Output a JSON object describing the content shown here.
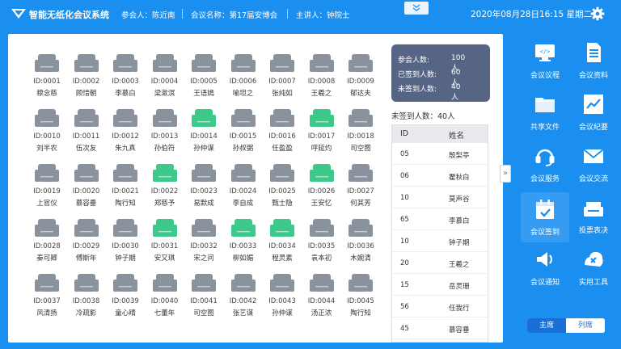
{
  "header": {
    "app_title": "智能无纸化会议系统",
    "participant": "参会人：陈近南",
    "meeting_name": "会议名称：第17届安博会",
    "speaker": "主讲人：钟院士",
    "datetime": "2020年08月28日16:15 星期二"
  },
  "colors": {
    "brand": "#1a8ff0",
    "seat_unsigned": "#8a929e",
    "seat_signed": "#3dc98a",
    "stats_bg": "#566485"
  },
  "seats": [
    {
      "id": "ID:0001",
      "name": "穆念慈",
      "signed": false
    },
    {
      "id": "ID:0002",
      "name": "顾惜朝",
      "signed": false
    },
    {
      "id": "ID:0003",
      "name": "李慕白",
      "signed": false
    },
    {
      "id": "ID:0004",
      "name": "梁漱溟",
      "signed": false
    },
    {
      "id": "ID:0005",
      "name": "王语嫣",
      "signed": false
    },
    {
      "id": "ID:0006",
      "name": "喻坦之",
      "signed": false
    },
    {
      "id": "ID:0007",
      "name": "张纯如",
      "signed": false
    },
    {
      "id": "ID:0008",
      "name": "王羲之",
      "signed": false
    },
    {
      "id": "ID:0009",
      "name": "郁达夫",
      "signed": false
    },
    {
      "id": "ID:0010",
      "name": "刘半农",
      "signed": false
    },
    {
      "id": "ID:0011",
      "name": "伍次友",
      "signed": false
    },
    {
      "id": "ID:0012",
      "name": "朱九真",
      "signed": false
    },
    {
      "id": "ID:0013",
      "name": "孙伯符",
      "signed": false
    },
    {
      "id": "ID:0014",
      "name": "孙仲谋",
      "signed": true
    },
    {
      "id": "ID:0015",
      "name": "孙叔弼",
      "signed": false
    },
    {
      "id": "ID:0016",
      "name": "任盈盈",
      "signed": false
    },
    {
      "id": "ID:0017",
      "name": "呼延灼",
      "signed": true
    },
    {
      "id": "ID:0018",
      "name": "司空图",
      "signed": false
    },
    {
      "id": "ID:0019",
      "name": "上官仪",
      "signed": false
    },
    {
      "id": "ID:0020",
      "name": "慕容垂",
      "signed": false
    },
    {
      "id": "ID:0021",
      "name": "陶行知",
      "signed": false
    },
    {
      "id": "ID:0022",
      "name": "郑慈予",
      "signed": true
    },
    {
      "id": "ID:0023",
      "name": "易默成",
      "signed": false
    },
    {
      "id": "ID:0024",
      "name": "李自成",
      "signed": false
    },
    {
      "id": "ID:0025",
      "name": "甄士隐",
      "signed": false
    },
    {
      "id": "ID:0026",
      "name": "王安忆",
      "signed": true
    },
    {
      "id": "ID:0027",
      "name": "何其芳",
      "signed": false
    },
    {
      "id": "ID:0028",
      "name": "秦可卿",
      "signed": false
    },
    {
      "id": "ID:0029",
      "name": "傅斯年",
      "signed": false
    },
    {
      "id": "ID:0030",
      "name": "钟子期",
      "signed": false
    },
    {
      "id": "ID:0031",
      "name": "安又琪",
      "signed": true
    },
    {
      "id": "ID:0032",
      "name": "宋之问",
      "signed": false
    },
    {
      "id": "ID:0033",
      "name": "柳如媚",
      "signed": true
    },
    {
      "id": "ID:0034",
      "name": "程灵素",
      "signed": true
    },
    {
      "id": "ID:0035",
      "name": "袁本初",
      "signed": false
    },
    {
      "id": "ID:0036",
      "name": "木婉清",
      "signed": false
    },
    {
      "id": "ID:0037",
      "name": "风清扬",
      "signed": false
    },
    {
      "id": "ID:0038",
      "name": "冷疏影",
      "signed": false
    },
    {
      "id": "ID:0039",
      "name": "童心晴",
      "signed": false
    },
    {
      "id": "ID:0040",
      "name": "七董年",
      "signed": false
    },
    {
      "id": "ID:0041",
      "name": "司空图",
      "signed": false
    },
    {
      "id": "ID:0042",
      "name": "张艺谋",
      "signed": false
    },
    {
      "id": "ID:0043",
      "name": "孙仲谋",
      "signed": false
    },
    {
      "id": "ID:0044",
      "name": "汤正浓",
      "signed": false
    },
    {
      "id": "ID:0045",
      "name": "陶行知",
      "signed": false
    }
  ],
  "stats": {
    "total_label": "参会人数:",
    "total_value": "100人",
    "signed_label": "已签到人数:",
    "signed_value": "60人",
    "unsigned_label": "未签到人数:",
    "unsigned_value": "40人"
  },
  "unsigned_summary": "未签到人数：40人",
  "unsigned_table": {
    "headers": [
      "ID",
      "姓名"
    ],
    "rows": [
      [
        "05",
        "殷梨亭"
      ],
      [
        "06",
        "瞿秋白"
      ],
      [
        "10",
        "莫声谷"
      ],
      [
        "65",
        "李慕白"
      ],
      [
        "10",
        "钟子期"
      ],
      [
        "20",
        "王羲之"
      ],
      [
        "15",
        "岳灵珊"
      ],
      [
        "56",
        "任我行"
      ],
      [
        "45",
        "慕容垂"
      ]
    ]
  },
  "side_handle": "»",
  "right_panel": {
    "items": [
      {
        "label": "会议议程",
        "icon": "monitor-icon"
      },
      {
        "label": "会议资料",
        "icon": "document-icon"
      },
      {
        "label": "共享文件",
        "icon": "folder-icon"
      },
      {
        "label": "会议纪要",
        "icon": "chart-icon"
      },
      {
        "label": "会议服务",
        "icon": "headset-icon"
      },
      {
        "label": "会议交流",
        "icon": "mail-icon"
      },
      {
        "label": "会议签到",
        "icon": "calendar-check-icon"
      },
      {
        "label": "投票表决",
        "icon": "ballot-box-icon"
      },
      {
        "label": "会议通知",
        "icon": "speaker-icon"
      },
      {
        "label": "实用工具",
        "icon": "tools-icon"
      }
    ],
    "active_index": 6,
    "toggle": {
      "left": "主席",
      "right": "列席",
      "selected": "主席"
    }
  }
}
